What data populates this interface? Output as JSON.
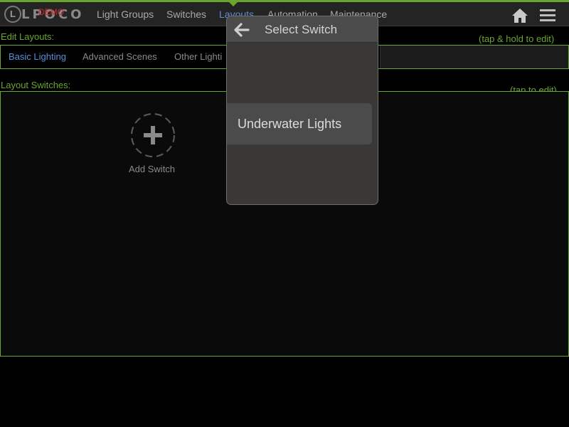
{
  "app": {
    "logo_text": "LPOCO",
    "demo_badge": "DEMO"
  },
  "nav": {
    "items": [
      {
        "label": "Light Groups",
        "active": false
      },
      {
        "label": "Switches",
        "active": false
      },
      {
        "label": "Layouts",
        "active": true
      },
      {
        "label": "Automation",
        "active": false
      },
      {
        "label": "Maintenance",
        "active": false
      }
    ],
    "home_icon": "home-icon",
    "menu_icon": "hamburger-menu-icon"
  },
  "edit_layouts": {
    "label": "Edit Layouts:",
    "hint": "(tap & hold to edit)",
    "tabs": [
      {
        "label": "Basic Lighting",
        "active": true
      },
      {
        "label": "Advanced Scenes",
        "active": false
      },
      {
        "label": "Other Lighti",
        "active": false
      }
    ]
  },
  "layout_switches": {
    "label": "Layout Switches:",
    "hint": "(tap to edit)",
    "add_switch_label": "Add Switch"
  },
  "modal": {
    "title": "Select Switch",
    "options": [
      "Underwater Lights"
    ]
  },
  "colors": {
    "accent_green": "#6aa52f",
    "active_blue": "#5b8fd6",
    "demo_red": "#d42a2a"
  }
}
